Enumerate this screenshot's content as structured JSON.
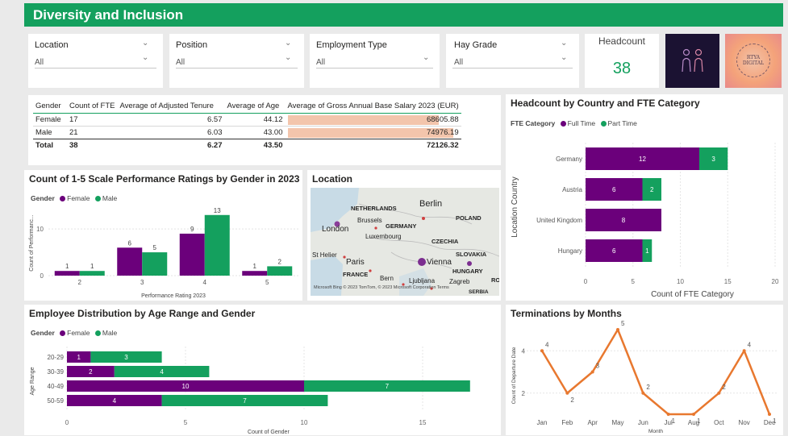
{
  "header": {
    "title": "Diversity and Inclusion"
  },
  "slicers": [
    {
      "label": "Location",
      "value": "All"
    },
    {
      "label": "Position",
      "value": "All"
    },
    {
      "label": "Employment Type",
      "value": "All"
    },
    {
      "label": "Hay Grade",
      "value": "All"
    }
  ],
  "headcount": {
    "label": "Headcount",
    "value": "38"
  },
  "logo": {
    "text": "RTYA DIGITAL"
  },
  "table": {
    "headers": [
      "Gender",
      "Count of FTE",
      "Average of Adjusted Tenure",
      "Average of Age",
      "Average of Gross Annual Base Salary 2023 (EUR)"
    ],
    "rows": [
      {
        "gender": "Female",
        "fte": "17",
        "tenure": "6.57",
        "age": "44.12",
        "salary": "68605.88",
        "salary_value": 68605.88
      },
      {
        "gender": "Male",
        "fte": "21",
        "tenure": "6.03",
        "age": "43.00",
        "salary": "74976.19",
        "salary_value": 74976.19
      }
    ],
    "total": {
      "gender": "Total",
      "fte": "38",
      "tenure": "6.27",
      "age": "43.50",
      "salary": "72126.32"
    },
    "bar_color": "#f3c5ac"
  },
  "colors": {
    "female": "#6b007b",
    "male": "#14a05e",
    "line": "#e8782f",
    "accent": "#14a05e"
  },
  "perf": {
    "title": "Count of 1-5 Scale Performance Ratings by Gender in 2023",
    "legend_title": "Gender",
    "female_label": "Female",
    "male_label": "Male",
    "xlabel": "Performance Rating 2023",
    "ylabel": "Count of Performanc...",
    "yticks": [
      "0",
      "10"
    ]
  },
  "map": {
    "title": "Location",
    "labels": {
      "netherlands": "NETHERLANDS",
      "berlin": "Berlin",
      "london": "London",
      "brussels": "Brussels",
      "germany": "GERMANY",
      "poland": "POLAND",
      "luxembourg": "Luxembourg",
      "czechia": "CZECHIA",
      "stheller": "St Helier",
      "paris": "Paris",
      "vienna": "Vienna",
      "slovakia": "SLOVAKIA",
      "france": "FRANCE",
      "bern": "Bern",
      "ljubljana": "Ljubljana",
      "zagreb": "Zagreb",
      "hungary": "HUNGARY",
      "ro": "RO",
      "serbia": "SERBIA",
      "copyright": "Microsoft Bing © 2023 TomTom, © 2023 Microsoft Corporation Terms"
    }
  },
  "country": {
    "title": "Headcount by Country and FTE Category",
    "legend_title": "FTE Category",
    "full_label": "Full Time",
    "part_label": "Part Time",
    "ylabel": "Location Country",
    "xlabel": "Count of FTE Category",
    "xticks": [
      "0",
      "5",
      "10",
      "15",
      "20"
    ]
  },
  "age": {
    "title": "Employee Distribution by Age Range and Gender",
    "legend_title": "Gender",
    "female_label": "Female",
    "male_label": "Male",
    "ylabel": "Age Range",
    "xlabel": "Count of Gender",
    "xticks": [
      "0",
      "5",
      "10",
      "15"
    ]
  },
  "term": {
    "title": "Terminations by Months",
    "ylabel": "Count of Departure Date",
    "xlabel": "Month",
    "yticks": [
      "2",
      "4"
    ]
  },
  "chart_data": [
    {
      "type": "bar",
      "title": "Count of 1-5 Scale Performance Ratings by Gender in 2023",
      "categories": [
        "2",
        "3",
        "4",
        "5"
      ],
      "series": [
        {
          "name": "Female",
          "values": [
            1,
            6,
            9,
            1
          ]
        },
        {
          "name": "Male",
          "values": [
            1,
            5,
            13,
            2
          ]
        }
      ],
      "xlabel": "Performance Rating 2023",
      "ylabel": "Count of Performanc...",
      "ylim": [
        0,
        14
      ]
    },
    {
      "type": "bar",
      "title": "Headcount by Country and FTE Category",
      "categories": [
        "Germany",
        "Austria",
        "United Kingdom",
        "Hungary"
      ],
      "series": [
        {
          "name": "Full Time",
          "values": [
            12,
            6,
            8,
            6
          ]
        },
        {
          "name": "Part Time",
          "values": [
            3,
            2,
            0,
            1
          ]
        }
      ],
      "xlabel": "Count of FTE Category",
      "ylabel": "Location Country",
      "xlim": [
        0,
        20
      ]
    },
    {
      "type": "bar",
      "title": "Employee Distribution by Age Range and Gender",
      "categories": [
        "20-29",
        "30-39",
        "40-49",
        "50-59"
      ],
      "series": [
        {
          "name": "Female",
          "values": [
            1,
            2,
            10,
            4
          ]
        },
        {
          "name": "Male",
          "values": [
            3,
            4,
            7,
            7
          ]
        }
      ],
      "xlabel": "Count of Gender",
      "ylabel": "Age Range",
      "xlim": [
        0,
        17
      ]
    },
    {
      "type": "line",
      "title": "Terminations by Months",
      "categories": [
        "Jan",
        "Feb",
        "Apr",
        "May",
        "Jun",
        "Jul",
        "Aug",
        "Oct",
        "Nov",
        "Dec"
      ],
      "values": [
        4,
        2,
        3,
        5,
        2,
        1,
        1,
        2,
        4,
        1
      ],
      "xlabel": "Month",
      "ylabel": "Count of Departure Date",
      "ylim": [
        1,
        5
      ]
    }
  ]
}
